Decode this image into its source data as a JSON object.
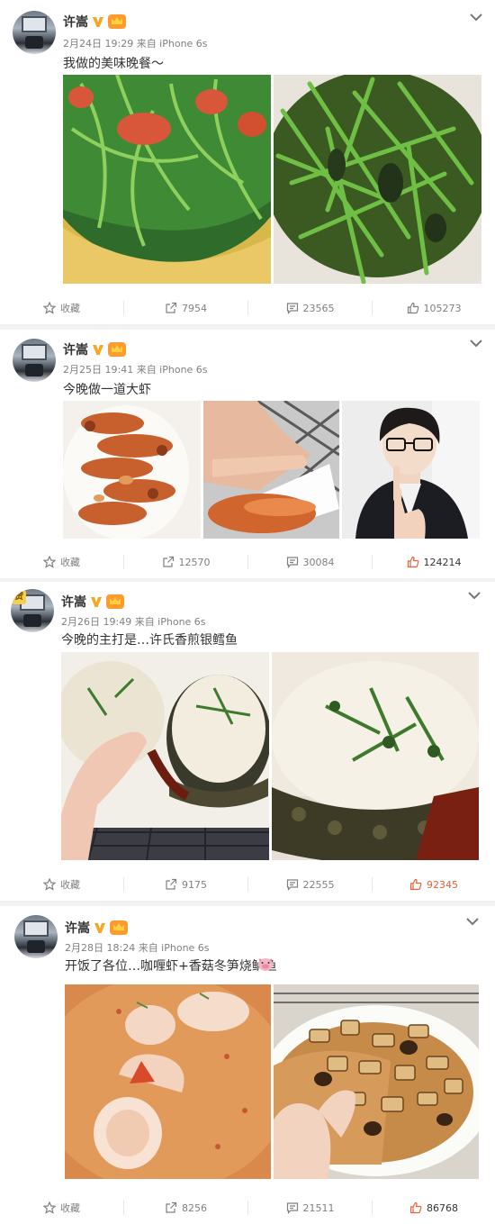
{
  "labels": {
    "favorite": "收藏"
  },
  "posts": [
    {
      "name": "许嵩",
      "meta": "2月24日 19:29 来自 iPhone 6s",
      "text": "我做的美味晚餐～",
      "reposts": "7954",
      "comments": "23565",
      "likes": "105273",
      "liked": false
    },
    {
      "name": "许嵩",
      "meta": "2月25日 19:41 来自 iPhone 6s",
      "text": "今晚做一道大虾",
      "reposts": "12570",
      "comments": "30084",
      "likes": "124214",
      "liked": false
    },
    {
      "name": "许嵩",
      "meta": "2月26日 19:49 来自 iPhone 6s",
      "text": "今晚的主打是…许氏香煎银鳕鱼",
      "avatar_badge": "赞",
      "reposts": "9175",
      "comments": "22555",
      "likes": "92345",
      "liked": true
    },
    {
      "name": "许嵩",
      "meta": "2月28日 18:24 来自 iPhone 6s",
      "text": "开饭了各位…咖喱虾+香菇冬笋烧鲈鱼",
      "reposts": "8256",
      "comments": "21511",
      "likes": "86768",
      "liked": false
    }
  ],
  "colors": {
    "verified": "#f5a623",
    "liked": "#e8613a",
    "meta": "#808080",
    "divider": "#f2f2f5"
  },
  "icons": [
    "star-icon",
    "repost-icon",
    "comment-icon",
    "thumbs-up-icon",
    "chevron-down-icon",
    "verified-v-icon",
    "vip-crown-icon"
  ]
}
